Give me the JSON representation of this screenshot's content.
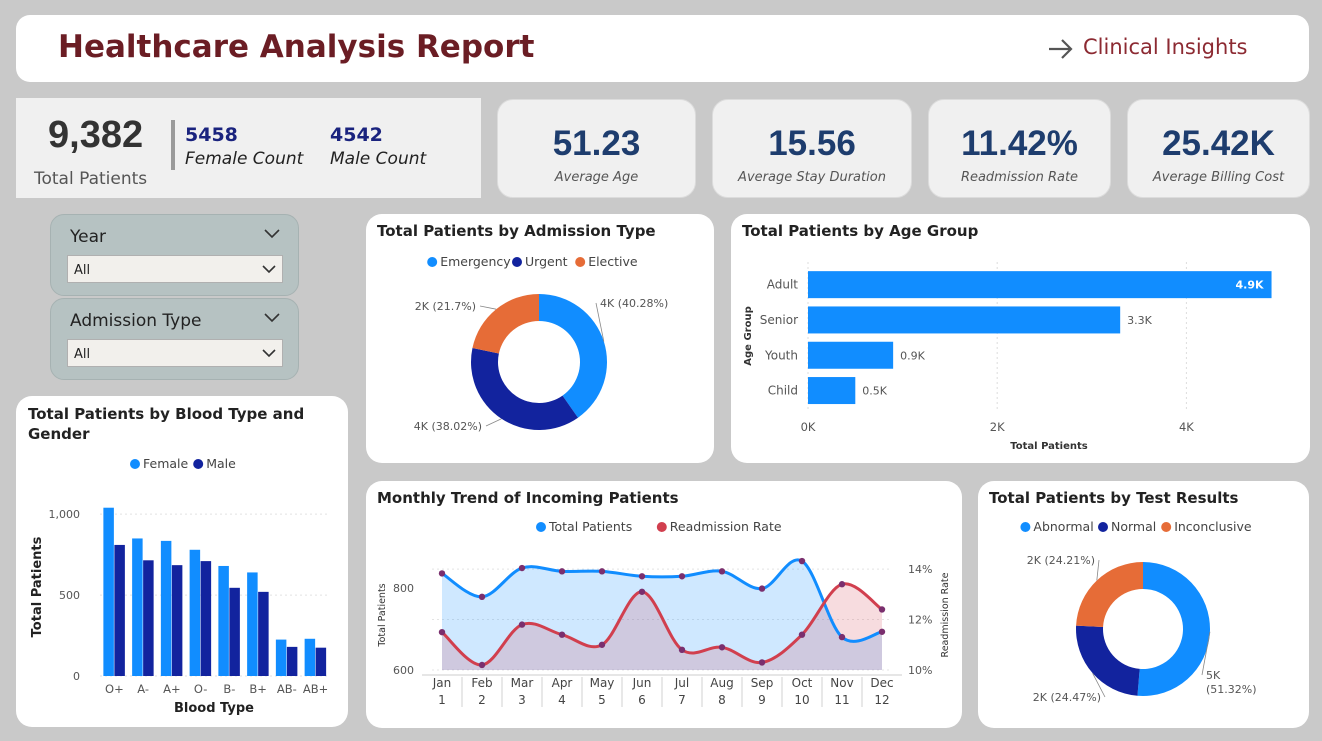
{
  "header": {
    "title": "Healthcare Analysis Report",
    "link_label": "Clinical Insights"
  },
  "patients": {
    "total": "9,382",
    "total_label": "Total Patients",
    "female_count": "5458",
    "female_label": "Female Count",
    "male_count": "4542",
    "male_label": "Male Count"
  },
  "kpis": [
    {
      "value": "51.23",
      "label": "Average Age"
    },
    {
      "value": "15.56",
      "label": "Average Stay Duration"
    },
    {
      "value": "11.42%",
      "label": "Readmission Rate"
    },
    {
      "value": "25.42K",
      "label": "Average Billing Cost"
    }
  ],
  "filters": [
    {
      "title": "Year",
      "selected": "All"
    },
    {
      "title": "Admission Type",
      "selected": "All"
    }
  ],
  "colors": {
    "light_blue": "#118dff",
    "dark_blue": "#12239e",
    "orange": "#e66c37",
    "red": "#d13f4e",
    "title_red": "#6b1d24"
  },
  "chart_data": [
    {
      "id": "admission",
      "type": "pie",
      "title": "Total Patients by Admission Type",
      "legend": [
        "Emergency",
        "Urgent",
        "Elective"
      ],
      "legend_position": "top",
      "values": [
        40.28,
        38.02,
        21.7
      ],
      "labels": [
        "4K (40.28%)",
        "4K (38.02%)",
        "2K (21.7%)"
      ]
    },
    {
      "id": "age",
      "type": "bar",
      "orientation": "horizontal",
      "title": "Total Patients by Age Group",
      "categories": [
        "Adult",
        "Senior",
        "Youth",
        "Child"
      ],
      "values": [
        4900,
        3300,
        900,
        500
      ],
      "data_labels": [
        "4.9K",
        "3.3K",
        "0.9K",
        "0.5K"
      ],
      "xlabel": "Total Patients",
      "ylabel": "Age Group",
      "xlim": [
        0,
        5000
      ],
      "xticks": [
        0,
        2000,
        4000
      ],
      "xtick_labels": [
        "0K",
        "2K",
        "4K"
      ]
    },
    {
      "id": "blood",
      "type": "bar",
      "title": "Total Patients by Blood Type and Gender",
      "categories": [
        "O+",
        "A-",
        "A+",
        "O-",
        "B-",
        "B+",
        "AB-",
        "AB+"
      ],
      "series": [
        {
          "name": "Female",
          "values": [
            1040,
            850,
            835,
            780,
            680,
            640,
            225,
            230
          ]
        },
        {
          "name": "Male",
          "values": [
            810,
            715,
            685,
            710,
            545,
            520,
            180,
            175
          ]
        }
      ],
      "xlabel": "Blood Type",
      "ylabel": "Total Patients",
      "ylim": [
        0,
        1100
      ],
      "yticks": [
        0,
        500,
        1000
      ],
      "ytick_labels": [
        "0",
        "500",
        "1,000"
      ]
    },
    {
      "id": "trend",
      "type": "line",
      "title": "Monthly Trend of Incoming Patients",
      "categories": [
        "Jan",
        "Feb",
        "Mar",
        "Apr",
        "May",
        "Jun",
        "Jul",
        "Aug",
        "Sep",
        "Oct",
        "Nov",
        "Dec"
      ],
      "sub_categories": [
        "1",
        "2",
        "3",
        "4",
        "5",
        "6",
        "7",
        "8",
        "9",
        "10",
        "11",
        "12"
      ],
      "series": [
        {
          "name": "Total Patients",
          "axis": "left",
          "values": [
            835,
            778,
            848,
            840,
            840,
            828,
            828,
            840,
            798,
            865,
            680,
            693
          ]
        },
        {
          "name": "Readmission Rate",
          "axis": "right",
          "values": [
            11.5,
            10.2,
            11.8,
            11.4,
            11.0,
            13.1,
            10.8,
            10.9,
            10.3,
            11.4,
            13.4,
            12.4
          ]
        }
      ],
      "ylabel_left": "Total Patients",
      "ylabel_right": "Readmission Rate",
      "ylim_left": [
        600,
        870
      ],
      "yticks_left": [
        600,
        800
      ],
      "ylim_right": [
        10,
        14.4
      ],
      "yticks_right": [
        10,
        12,
        14
      ],
      "ytick_labels_right": [
        "10%",
        "12%",
        "14%"
      ]
    },
    {
      "id": "tests",
      "type": "pie",
      "title": "Total Patients by Test Results",
      "legend": [
        "Abnormal",
        "Normal",
        "Inconclusive"
      ],
      "legend_position": "top",
      "values": [
        51.32,
        24.47,
        24.21
      ],
      "labels": [
        "5K (51.32%)",
        "2K (24.47%)",
        "2K (24.21%)"
      ]
    }
  ]
}
